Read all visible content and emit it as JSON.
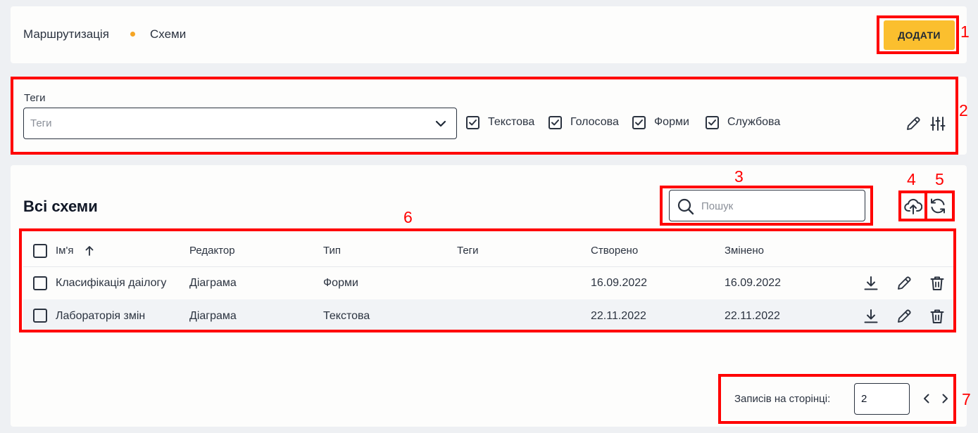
{
  "breadcrumb": {
    "root": "Маршрутизація",
    "current": "Схеми"
  },
  "header": {
    "add_label": "ДОДАТИ"
  },
  "filter": {
    "tags_label": "Теги",
    "tags_placeholder": "Теги",
    "checkboxes": [
      {
        "label": "Текстова",
        "checked": true
      },
      {
        "label": "Голосова",
        "checked": true
      },
      {
        "label": "Форми",
        "checked": true
      },
      {
        "label": "Службова",
        "checked": true
      }
    ]
  },
  "list": {
    "title": "Всі схеми",
    "search_placeholder": "Пошук",
    "columns": [
      "Ім'я",
      "Редактор",
      "Тип",
      "Теги",
      "Створено",
      "Змінено"
    ],
    "sort": {
      "column": "Ім'я",
      "direction": "asc"
    },
    "rows": [
      {
        "name": "Класифікація даілогу",
        "editor": "Діаграма",
        "type": "Форми",
        "tags": "",
        "created": "16.09.2022",
        "modified": "16.09.2022"
      },
      {
        "name": "Лабораторія змін",
        "editor": "Діаграма",
        "type": "Текстова",
        "tags": "",
        "created": "22.11.2022",
        "modified": "22.11.2022"
      }
    ]
  },
  "pagination": {
    "per_page_label": "Записів на сторінці:",
    "per_page_value": "2"
  },
  "callouts": [
    "1",
    "2",
    "3",
    "4",
    "5",
    "6",
    "7"
  ],
  "colors": {
    "accent": "#fbbf2e",
    "annotation": "#ff0000",
    "row_alt": "#f1f3f6",
    "text": "#2b3340"
  }
}
